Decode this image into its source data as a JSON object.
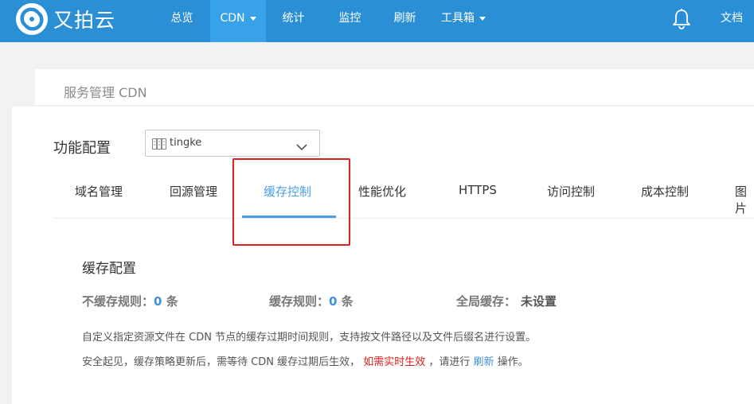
{
  "brand": {
    "name": "又拍云"
  },
  "nav": {
    "overview": "总览",
    "cdn": "CDN",
    "stats": "统计",
    "monitor": "监控",
    "refresh": "刷新",
    "toolbox": "工具箱",
    "docs": "文档"
  },
  "breadcrumb": "服务管理 CDN",
  "config": {
    "label": "功能配置",
    "domain": "tingke"
  },
  "tabs": [
    "域名管理",
    "回源管理",
    "缓存控制",
    "性能优化",
    "HTTPS",
    "访问控制",
    "成本控制",
    "图片"
  ],
  "active_tab_index": 2,
  "section": {
    "title": "缓存配置",
    "no_cache_label": "不缓存规则：",
    "no_cache_count": "0",
    "cache_label": "缓存规则：",
    "cache_count": "0",
    "unit": "条",
    "global_label": "全局缓存：",
    "global_value": "未设置",
    "desc1": "自定义指定资源文件在 CDN 节点的缓存过期时间规则，支持按文件路径以及文件后缀名进行设置。",
    "desc2_pre": "安全起见，缓存策略更新后，需等待 CDN 缓存过期后生效，",
    "desc2_red": "如需实时生效",
    "desc2_mid": "，请进行",
    "desc2_link": "刷新",
    "desc2_post": "操作。"
  },
  "colors": {
    "topbar": "#2b8fd6",
    "nav_active": "#37a2e9",
    "accent": "#4a9ee8",
    "highlight_box": "#e02020"
  },
  "icons": {
    "logo": "upyun-logo-icon",
    "bell": "bell-icon",
    "dropdown": "chevron-down-icon",
    "domain": "domain-icon"
  }
}
